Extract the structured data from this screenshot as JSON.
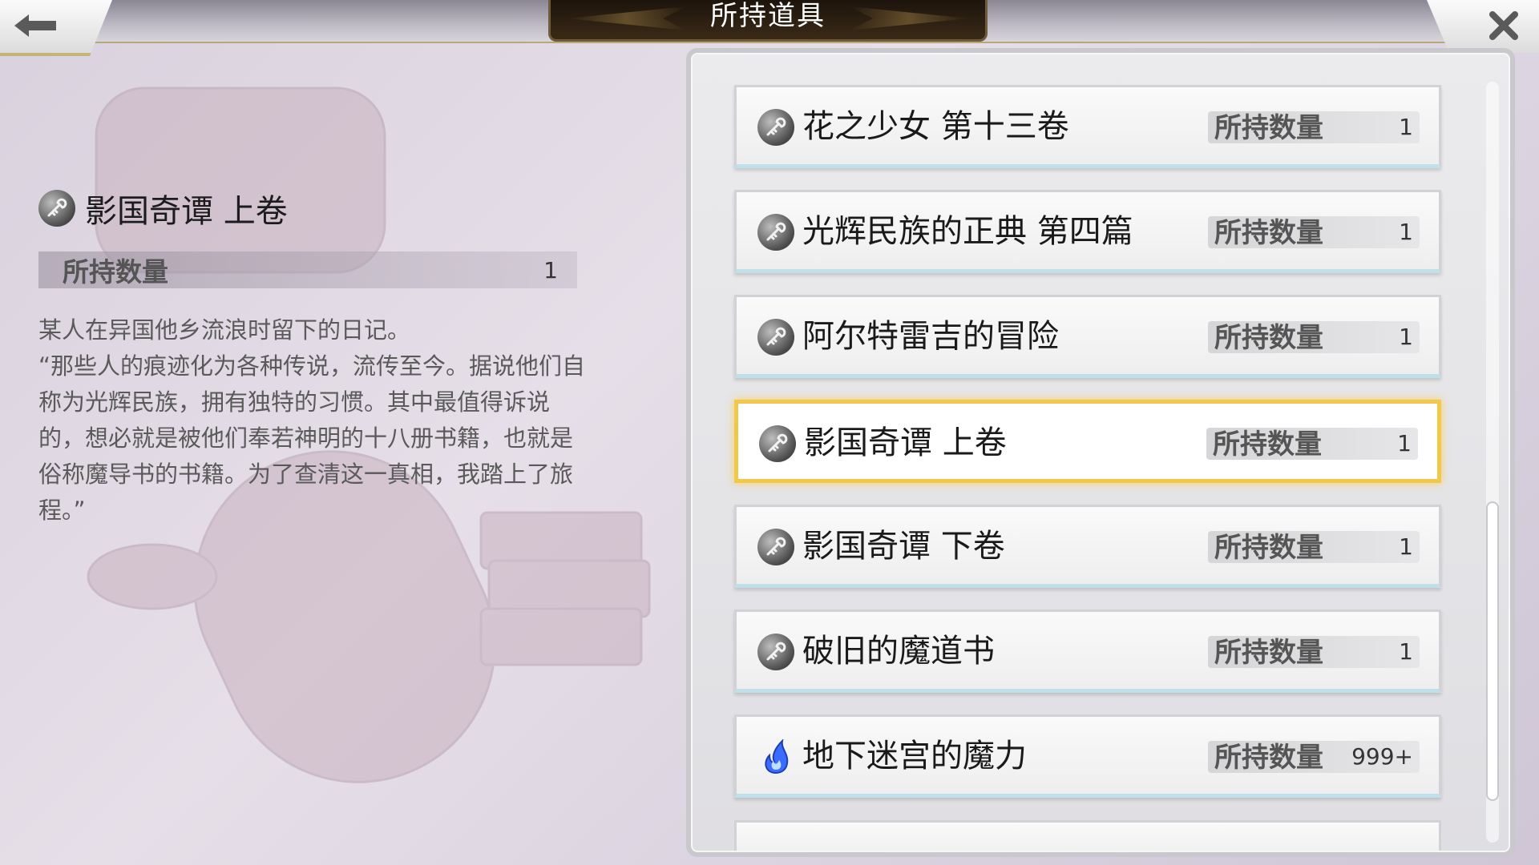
{
  "header": {
    "title": "所持道具",
    "back_icon": "back-arrow-icon",
    "close_icon": "close-icon"
  },
  "detail": {
    "name": "影国奇谭 上卷",
    "icon": "book-key-icon",
    "count_label": "所持数量",
    "count_value": "1",
    "description": "某人在异国他乡流浪时留下的日记。\n“那些人的痕迹化为各种传说，流传至今。据说他们自称为光辉民族，拥有独特的习惯。其中最值得诉说的，想必就是被他们奉若神明的十八册书籍，也就是俗称魔导书的书籍。为了查清这一真相，我踏上了旅程。”"
  },
  "items": [
    {
      "name": "花之少女 第十三卷",
      "count_label": "所持数量",
      "count": "1",
      "icon": "book-key-icon",
      "selected": false
    },
    {
      "name": "光辉民族的正典 第四篇",
      "count_label": "所持数量",
      "count": "1",
      "icon": "book-key-icon",
      "selected": false
    },
    {
      "name": "阿尔特雷吉的冒险",
      "count_label": "所持数量",
      "count": "1",
      "icon": "book-key-icon",
      "selected": false
    },
    {
      "name": "影国奇谭 上卷",
      "count_label": "所持数量",
      "count": "1",
      "icon": "book-key-icon",
      "selected": true
    },
    {
      "name": "影国奇谭 下卷",
      "count_label": "所持数量",
      "count": "1",
      "icon": "book-key-icon",
      "selected": false
    },
    {
      "name": "破旧的魔道书",
      "count_label": "所持数量",
      "count": "1",
      "icon": "book-key-icon",
      "selected": false
    },
    {
      "name": "地下迷宫的魔力",
      "count_label": "所持数量",
      "count": "999+",
      "icon": "blue-flame-icon",
      "selected": false
    }
  ],
  "colors": {
    "selected_border": "#f2c84b",
    "title_plate": "#2a1d10",
    "flame": "#3a6cff"
  }
}
